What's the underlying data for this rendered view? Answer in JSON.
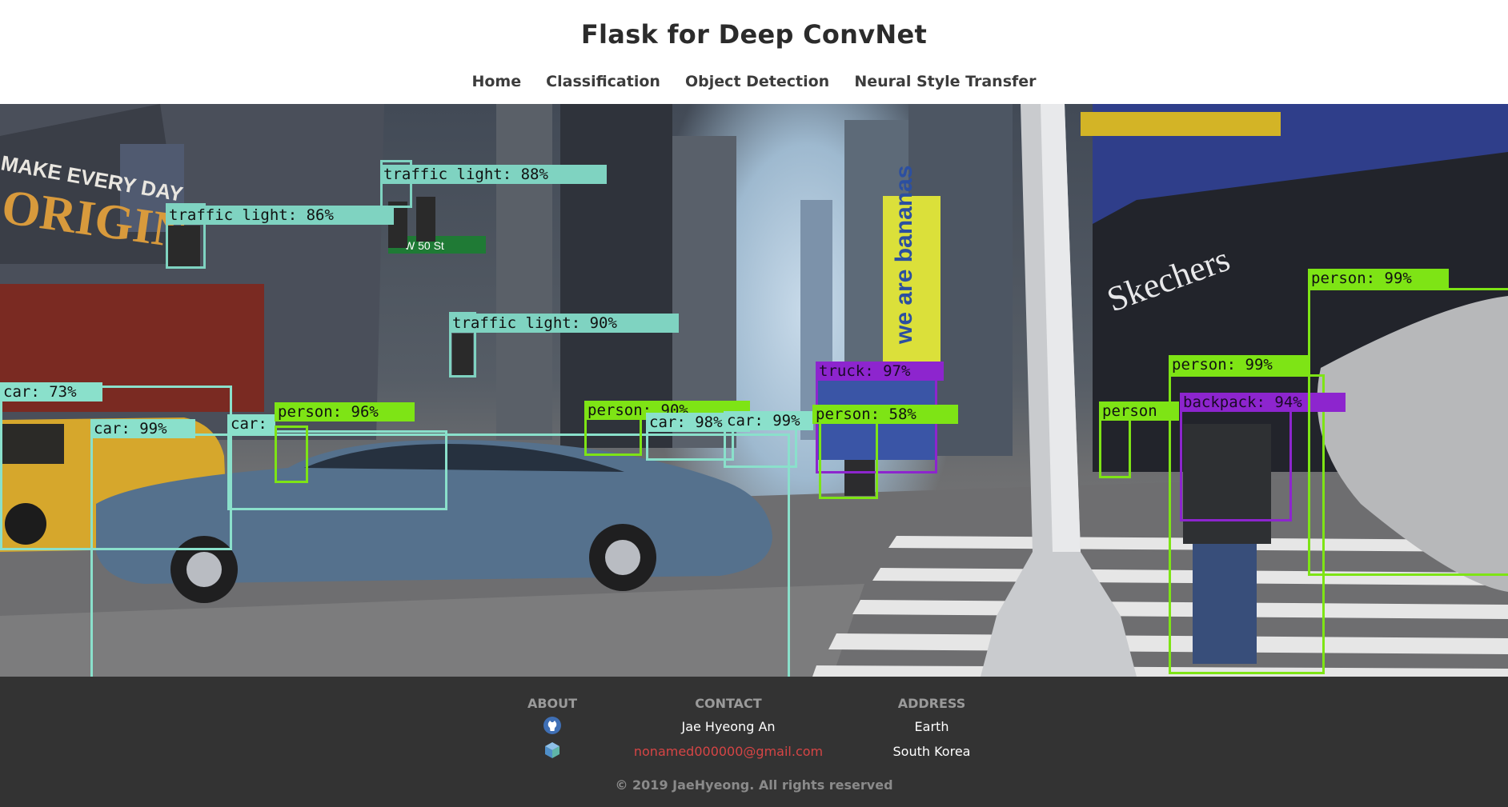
{
  "header": {
    "title": "Flask for Deep ConvNet",
    "nav": [
      {
        "label": "Home"
      },
      {
        "label": "Classification"
      },
      {
        "label": "Object Detection"
      },
      {
        "label": "Neural Style Transfer"
      }
    ]
  },
  "hero": {
    "scene_text": {
      "billboard_top": "MAKE EVERY DAY",
      "billboard_big": "ORIGIN",
      "street_sign": "W 50 St",
      "banner": "we are bananas",
      "store_sign": "Skechers"
    },
    "detections": [
      {
        "label": "traffic light: 88%"
      },
      {
        "label": "traffic light: 86%"
      },
      {
        "label": "traffic light: 90%"
      },
      {
        "label": "car: 73%"
      },
      {
        "label": "car: 99%"
      },
      {
        "label": "car: 97%"
      },
      {
        "label": "person: 96%"
      },
      {
        "label": "person: 90%"
      },
      {
        "label": "car: 98%"
      },
      {
        "label": "car: 99%"
      },
      {
        "label": "person: 58%"
      },
      {
        "label": "truck: 97%"
      },
      {
        "label": "person: 99%"
      },
      {
        "label": "backpack: 94%"
      },
      {
        "label": "person"
      },
      {
        "label": "person: 99%"
      }
    ],
    "colors": {
      "car": "#8ae0cb",
      "traffic_light": "#7fd3c1",
      "person": "#7ee415",
      "backpack": "#8d25ce"
    }
  },
  "footer": {
    "about": {
      "heading": "ABOUT",
      "icons": [
        "github-icon",
        "cube-icon"
      ]
    },
    "contact": {
      "heading": "CONTACT",
      "name": "Jae Hyeong An",
      "email": "nonamed000000@gmail.com"
    },
    "address": {
      "heading": "ADDRESS",
      "line1": "Earth",
      "line2": "South Korea"
    },
    "copyright": "© 2019 JaeHyeong. All rights reserved",
    "colors": {
      "background": "#333333",
      "link": "#d64545",
      "heading": "#9a9a9a"
    }
  }
}
